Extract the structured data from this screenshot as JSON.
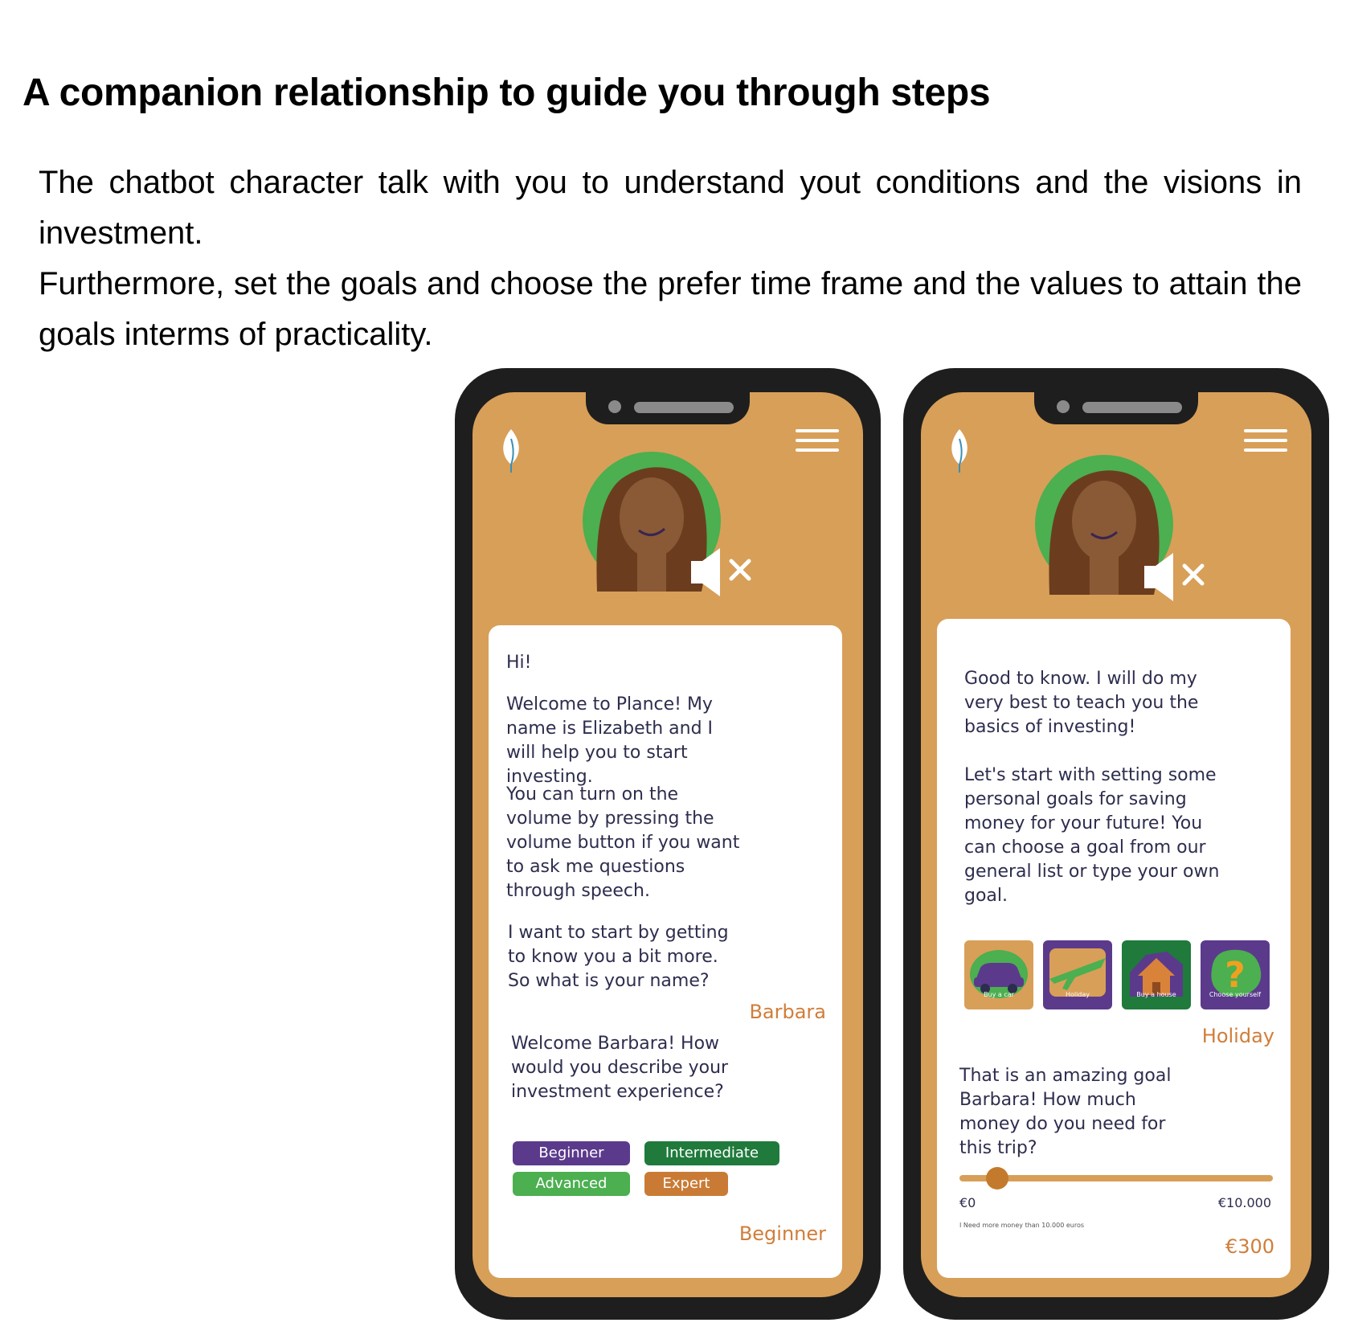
{
  "heading": "A companion relationship to guide you through steps",
  "intro": {
    "line1": "The chatbot character talk with you to understand yout conditions and the visions in investment.",
    "line2": "Furthermore, set the goals and choose the prefer time frame and the values to attain the goals interms of practicality."
  },
  "phone1": {
    "messages": {
      "hi": "Hi!",
      "welcome": "Welcome to Plance! My name is Elizabeth and I will help you to start investing.",
      "volume": "You can turn on the volume by pressing the volume button if you want to ask me questions through speech.",
      "name_question": "I want to start by getting to know you a bit more. So what is your name?",
      "name_reply": "Barbara",
      "experience_question": "Welcome Barbara! How would you describe your investment experience?",
      "experience_reply": "Beginner"
    },
    "options": [
      {
        "label": "Beginner",
        "color": "#5b3a8c"
      },
      {
        "label": "Intermediate",
        "color": "#1f7a3c"
      },
      {
        "label": "Advanced",
        "color": "#4caf50"
      },
      {
        "label": "Expert",
        "color": "#c97b35"
      }
    ]
  },
  "phone2": {
    "messages": {
      "good": "Good to know. I will do my very best to teach you the basics of investing!",
      "goals": "Let's start with setting some personal goals for saving money for your future! You can choose a goal from our general list or type your own goal.",
      "goal_reply": "Holiday",
      "amount_question": "That is an amazing goal Barbara! How much money do you need for this trip?",
      "amount_reply": "€300"
    },
    "goals": [
      {
        "label": "Buy a car",
        "icon": "car-icon",
        "bg": "#d89f58"
      },
      {
        "label": "Holiday",
        "icon": "airplane-icon",
        "bg": "#5b3a8c"
      },
      {
        "label": "Buy a house",
        "icon": "house-icon",
        "bg": "#1f7a3c"
      },
      {
        "label": "Choose yourself",
        "icon": "question-icon",
        "bg": "#5b3a8c"
      }
    ],
    "slider": {
      "min_label": "€0",
      "max_label": "€10.000",
      "value_fraction": 0.12,
      "note": "I Need more money than 10.000 euros"
    }
  },
  "colors": {
    "screen_bg": "#d89f58",
    "frame": "#1e1e1e",
    "accent_text": "#d07e3a",
    "avatar_ring": "#4caf50"
  }
}
